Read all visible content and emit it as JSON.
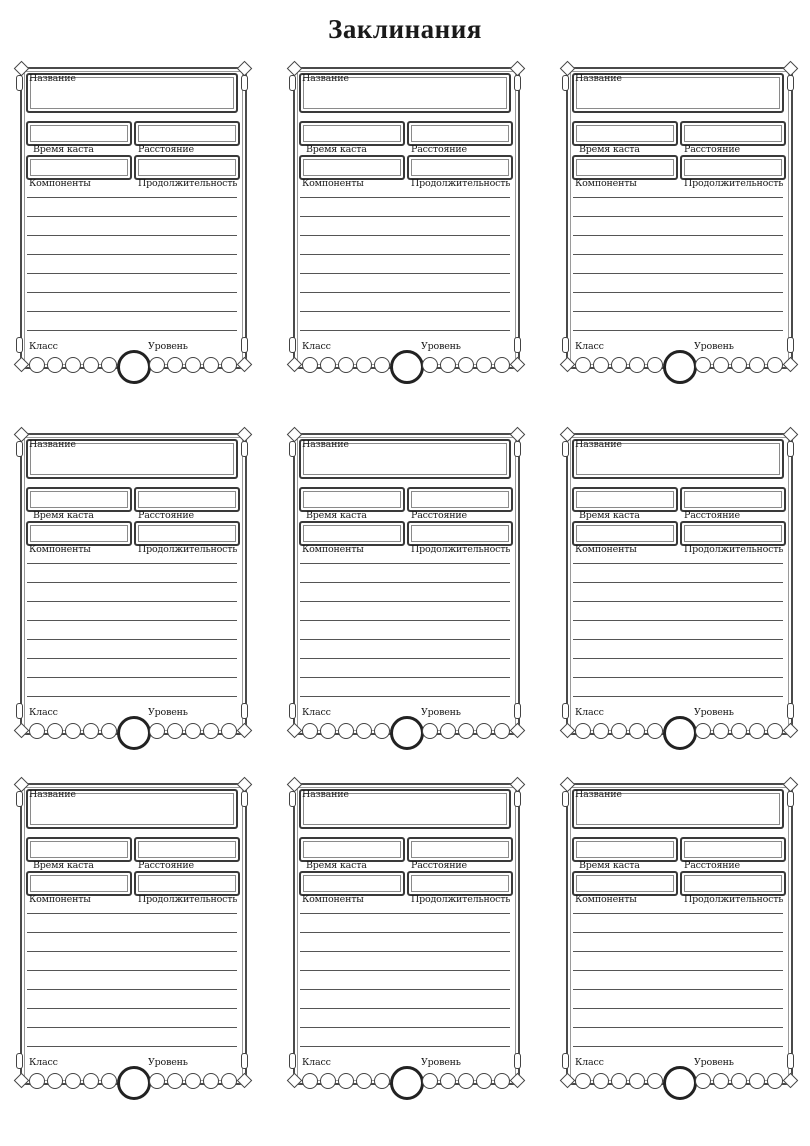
{
  "title": "Заклинания",
  "labels": {
    "name": "Название",
    "cast_time": "Время каста",
    "range": "Расстояние",
    "components": "Компоненты",
    "duration": "Продолжительность",
    "class": "Класс",
    "level": "Уровень"
  },
  "card_count": 9,
  "description_line_count": 8,
  "slot_circles_per_side": 5
}
